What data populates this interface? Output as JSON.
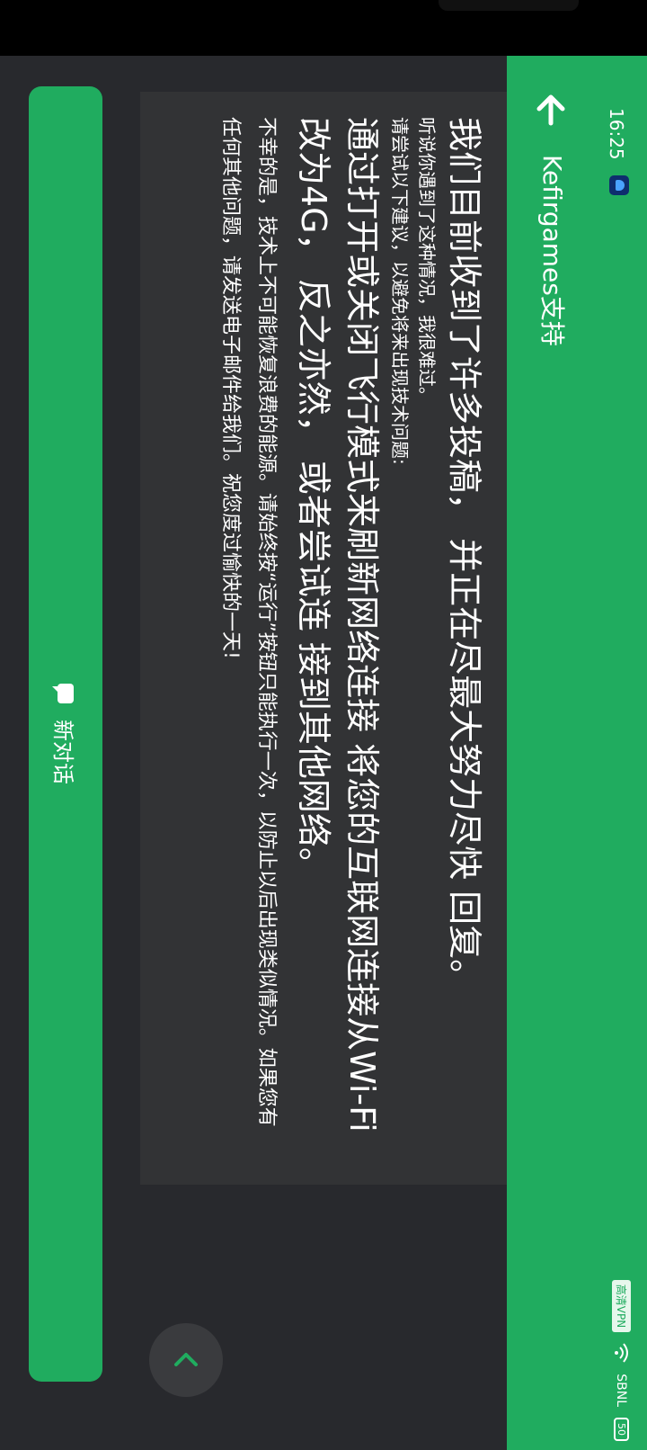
{
  "status_bar": {
    "time": "16:25",
    "vpn_label": "高清VPN",
    "carrier": "SBNL",
    "battery": "50"
  },
  "header": {
    "back_icon": "arrow-left-icon",
    "title": "Kefirgames支持"
  },
  "message": {
    "heading": "我们目前收到了许多投稿， 并正在尽最大努力尽快 回复。",
    "line1": "听说你遇到了这种情况，我很难过。",
    "line2": "请尝试以下建议，以避免将来出现技术问题:",
    "tip": "通过打开或关闭飞行模式来刷新网络连接 将您的互联网连接从Wi-Fi改为4G， 反之亦然， 或者尝试连 接到其他网络。",
    "body": "不幸的是，技术上不可能恢复浪费的能源。请始终按“运行”按钮只能执行一次，以防止以后出现类似情况。如果您有任何其他问题，请发送电子邮件给我们。祝您度过愉快的一天!"
  },
  "sidebar": {
    "new_chat_label": "新对话",
    "new_chat_icon": "chat-bubble-icon",
    "collapse_icon": "chevron-left-icon"
  },
  "colors": {
    "accent": "#20ac5f",
    "background": "#28292d",
    "panel": "#323335"
  }
}
